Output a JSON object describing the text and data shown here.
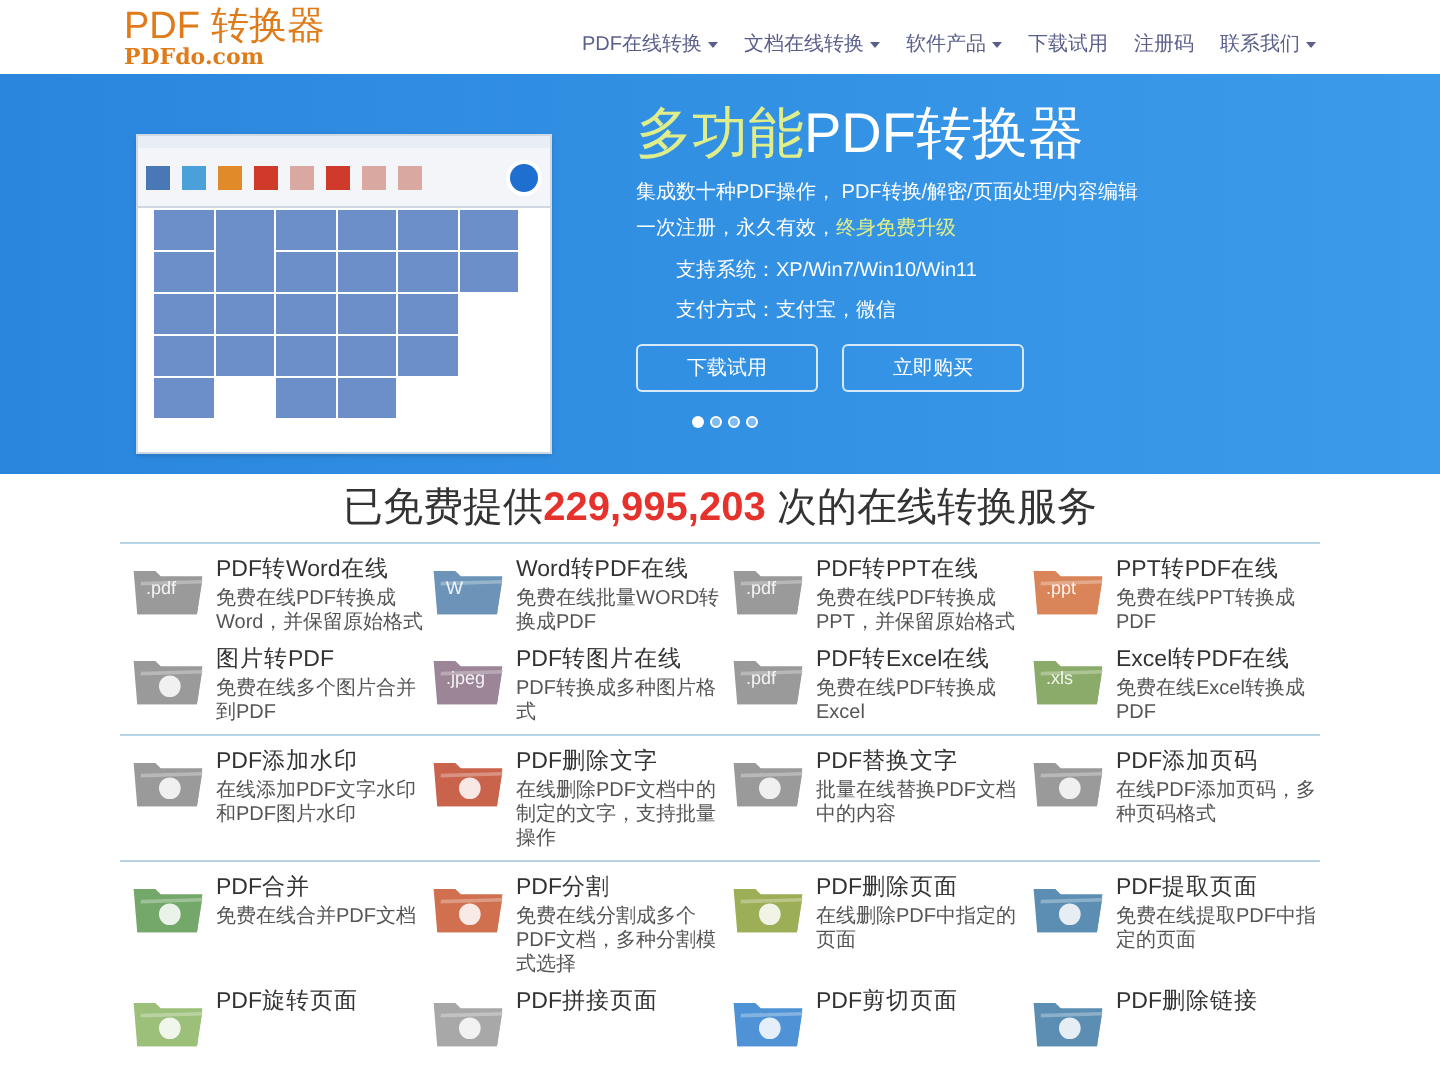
{
  "logo": {
    "title": "PDF 转换器",
    "subtitle": "PDFdo.com"
  },
  "nav": [
    {
      "label": "PDF在线转换",
      "dropdown": true
    },
    {
      "label": "文档在线转换",
      "dropdown": true
    },
    {
      "label": "软件产品",
      "dropdown": true
    },
    {
      "label": "下载试用",
      "dropdown": false
    },
    {
      "label": "注册码",
      "dropdown": false
    },
    {
      "label": "联系我们",
      "dropdown": true
    }
  ],
  "hero": {
    "title_highlight": "多功能",
    "title_rest": "PDF转换器",
    "line_1": "集成数十种PDF操作， PDF转换/解密/页面处理/内容编辑",
    "line_2": "一次注册，永久有效，",
    "line_2_highlight": "终身免费升级",
    "system": "支持系统：XP/Win7/Win10/Win11",
    "payment": "支付方式：支付宝，微信",
    "buttons": [
      "下载试用",
      "立即购买"
    ],
    "dots": [
      {
        "selected": true
      },
      {
        "selected": false
      },
      {
        "selected": false
      },
      {
        "selected": false
      }
    ]
  },
  "headline": {
    "before": "已免费提供",
    "count": "229,995,203",
    "after": " 次的在线转换服务"
  },
  "groups": [
    [
      {
        "title": "PDF转Word在线",
        "desc": "免费在线PDF转换成Word，并保留原始格式",
        "color": "#9a9a9a",
        "label": ".pdf"
      },
      {
        "title": "Word转PDF在线",
        "desc": "免费在线批量WORD转换成PDF",
        "color": "#6b94b8",
        "label": "W"
      },
      {
        "title": "PDF转PPT在线",
        "desc": "免费在线PDF转换成PPT，并保留原始格式",
        "color": "#9a9a9a",
        "label": ".pdf"
      },
      {
        "title": "PPT转PDF在线",
        "desc": "免费在线PPT转换成PDF",
        "color": "#d98559",
        "label": ".ppt"
      },
      {
        "title": "图片转PDF",
        "desc": "免费在线多个图片合并到PDF",
        "color": "#9a9a9a"
      },
      {
        "title": "PDF转图片在线",
        "desc": "PDF转换成多种图片格式",
        "color": "#9b8597",
        "label": ".jpeg"
      },
      {
        "title": "PDF转Excel在线",
        "desc": "免费在线PDF转换成Excel",
        "color": "#9a9a9a",
        "label": ".pdf"
      },
      {
        "title": "Excel转PDF在线",
        "desc": "免费在线Excel转换成PDF",
        "color": "#8aab69",
        "label": ".xls"
      }
    ],
    [
      {
        "title": "PDF添加水印",
        "desc": "在线添加PDF文字水印和PDF图片水印",
        "color": "#9a9a9a"
      },
      {
        "title": "PDF删除文字",
        "desc": "在线删除PDF文档中的制定的文字，支持批量操作",
        "color": "#c9634b"
      },
      {
        "title": "PDF替换文字",
        "desc": "批量在线替换PDF文档中的内容",
        "color": "#9a9a9a"
      },
      {
        "title": "PDF添加页码",
        "desc": "在线PDF添加页码，多种页码格式",
        "color": "#9a9a9a"
      }
    ],
    [
      {
        "title": "PDF合并",
        "desc": "免费在线合并PDF文档",
        "color": "#74a86a"
      },
      {
        "title": "PDF分割",
        "desc": "免费在线分割成多个PDF文档，多种分割模式选择",
        "color": "#d0704f"
      },
      {
        "title": "PDF删除页面",
        "desc": "在线删除PDF中指定的页面",
        "color": "#9cae56"
      },
      {
        "title": "PDF提取页面",
        "desc": "免费在线提取PDF中指定的页面",
        "color": "#5b8eb2"
      },
      {
        "title": "PDF旋转页面",
        "color": "#9cbf7a"
      },
      {
        "title": "PDF拼接页面",
        "color": "#a8a8a8"
      },
      {
        "title": "PDF剪切页面",
        "color": "#4f93d6"
      },
      {
        "title": "PDF删除链接",
        "color": "#5b8eb2"
      }
    ]
  ]
}
